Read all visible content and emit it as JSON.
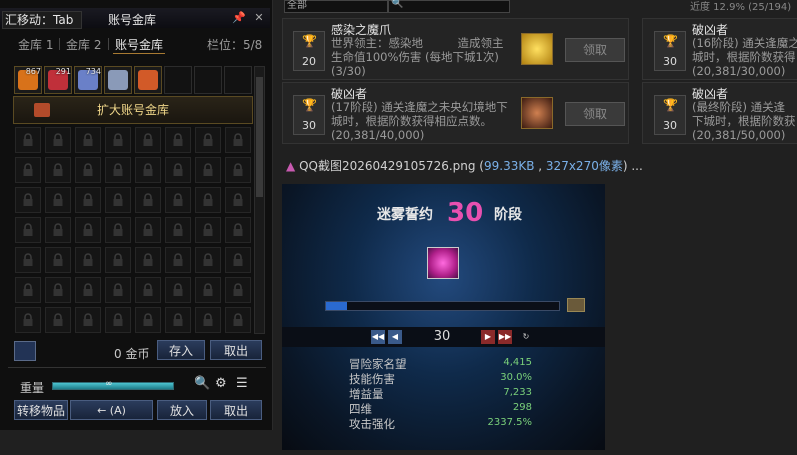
{
  "vault": {
    "title_left": "汇移动：Tab",
    "title": "账号金库",
    "tabs": [
      "金库 1",
      "金库 2",
      "账号金库"
    ],
    "slot_info": "栏位：5/8",
    "items": [
      {
        "badge": "867",
        "color": "#d8721a"
      },
      {
        "badge": "291",
        "color": "#c0303a"
      },
      {
        "badge": "734",
        "color": "#6a80c8"
      },
      {
        "badge": "",
        "color": "#8a9ab8"
      },
      {
        "badge": "",
        "color": "#d25a28"
      }
    ],
    "expand_button": "扩大账号金库",
    "gold_amount": "0 金币",
    "deposit": "存入",
    "withdraw": "取出",
    "weight_label": "重量",
    "weight_value": "∞",
    "transfer_items": "转移物品",
    "transfer_mode": "←  (A)",
    "put_in": "放入",
    "take_out": "取出"
  },
  "top": {
    "select": "全部",
    "right_text": "近度 12.9% (25/194)"
  },
  "achievements": [
    {
      "points": "20",
      "title": "感染之魔爪",
      "desc": "世界领主：感染地　　　造成领主\n生命值100%伤害 (每地下城1次)\n(3/30)",
      "claim": "领取"
    },
    {
      "points": "30",
      "title": "破凶者",
      "desc": "(16阶段) 通关逢魔之\n城时，根据阶数获得\n(20,381/30,000)"
    },
    {
      "points": "30",
      "title": "破凶者",
      "desc": "(17阶段) 通关逢魔之未央幻境地下\n城时，根据阶数获得相应点数。\n(20,381/40,000)",
      "claim": "领取"
    },
    {
      "points": "30",
      "title": "破凶者",
      "desc": "(最终阶段) 通关逢\n下城时，根据阶数获\n(20,381/50,000)"
    }
  ],
  "file": {
    "name": "QQ截图20260429105726.png (",
    "size": "99.33KB",
    "comma": " , ",
    "dims": "327x270像素",
    "tail": ") ..."
  },
  "shot": {
    "title": "迷雾誓约",
    "stage_num": "30",
    "stage_label": "阶段",
    "progress": 0.09,
    "nav_value": "30",
    "stats": [
      {
        "label": "冒险家名望",
        "value": "4,415"
      },
      {
        "label": "技能伤害",
        "value": "30.0%"
      },
      {
        "label": "增益量",
        "value": "7,233"
      },
      {
        "label": "四维",
        "value": "298"
      },
      {
        "label": "攻击强化",
        "value": "2337.5%"
      }
    ]
  }
}
